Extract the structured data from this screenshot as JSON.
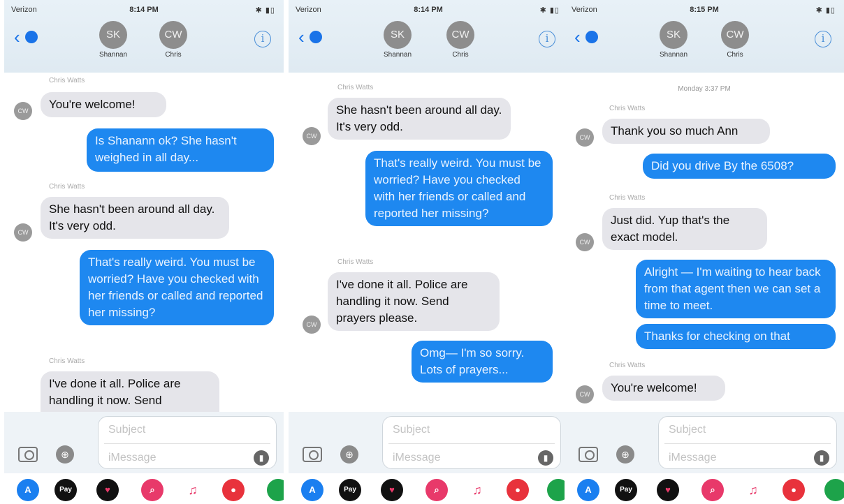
{
  "status": {
    "carrier": "Verizon",
    "battery": "✱ ▮▯"
  },
  "contacts": [
    {
      "initials": "SK",
      "name": "Shannan"
    },
    {
      "initials": "CW",
      "name": "Chris"
    }
  ],
  "nav": {
    "back_badge": "",
    "info_label": "i"
  },
  "compose": {
    "subject_placeholder": "Subject",
    "message_placeholder": "iMessage"
  },
  "colors": {
    "outgoing": "#1e88f0",
    "incoming": "#e5e5ea",
    "header": "#e8f1f7"
  },
  "app_icons": [
    {
      "name": "app-store-icon",
      "glyph": "A",
      "color": "#1a7ff0"
    },
    {
      "name": "apple-pay-icon",
      "glyph": "Pay",
      "color": "#111111"
    },
    {
      "name": "digital-touch-icon",
      "glyph": "♥",
      "color": "#111111"
    },
    {
      "name": "images-search-icon",
      "glyph": "⌕",
      "color": "#e8396a"
    },
    {
      "name": "music-icon",
      "glyph": "♫",
      "color": "#ffffff"
    },
    {
      "name": "video-app-icon",
      "glyph": "●",
      "color": "#e8323c"
    },
    {
      "name": "green-app-icon",
      "glyph": "",
      "color": "#1da34a"
    }
  ],
  "screens": [
    {
      "time": "8:14 PM",
      "messages": [
        {
          "sender": "Chris Watts",
          "initials": "CW",
          "text": "You're welcome!"
        },
        {
          "text": "Is Shanann ok? She hasn't weighed in all day..."
        },
        {
          "sender": "Chris Watts",
          "initials": "CW",
          "text": "She hasn't been around all day. It's very odd."
        },
        {
          "text": "That's really weird. You must be worried? Have you checked with her friends or called and reported her missing?"
        },
        {
          "sender": "Chris Watts",
          "text": "I've done it all. Police are handling it now. Send"
        }
      ]
    },
    {
      "time": "8:14 PM",
      "messages": [
        {
          "sender": "Chris Watts",
          "initials": "CW",
          "text": "She hasn't been around all day. It's very odd."
        },
        {
          "text": "That's really weird. You must be worried? Have you checked with her friends or called and reported her missing?"
        },
        {
          "sender": "Chris Watts",
          "initials": "CW",
          "text": "I've done it all. Police are handling it now. Send prayers please."
        },
        {
          "text": "Omg— I'm so sorry. Lots of prayers..."
        }
      ]
    },
    {
      "time": "8:15 PM",
      "timestamp": "Monday 3:37 PM",
      "messages": [
        {
          "sender": "Chris Watts",
          "initials": "CW",
          "text": "Thank you so much Ann"
        },
        {
          "text": "Did you drive By the 6508?"
        },
        {
          "sender": "Chris Watts",
          "initials": "CW",
          "text": "Just did. Yup that's the exact model."
        },
        {
          "text": "Alright — I'm waiting to hear back from that agent then we can set a time to meet."
        },
        {
          "text": "Thanks for checking on that"
        },
        {
          "sender": "Chris Watts",
          "initials": "CW",
          "text": "You're welcome!"
        }
      ]
    }
  ]
}
